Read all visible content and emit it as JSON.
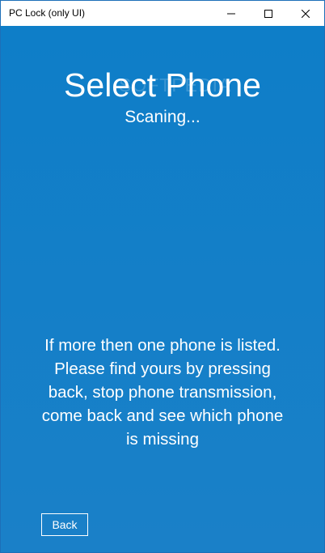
{
  "window": {
    "title": "PC Lock (only UI)"
  },
  "titlebar_controls": {
    "minimize_icon": "minimize-icon",
    "maximize_icon": "maximize-icon",
    "close_icon": "close-icon"
  },
  "main": {
    "heading": "Select Phone",
    "status": "Scaning...",
    "instructions": "If more then one phone is listed. Please find yours by pressing back, stop phone transmission, come back and see which phone is missing",
    "back_label": "Back",
    "watermark": "SOFTPEDIA"
  },
  "colors": {
    "background": "#0e7ec8",
    "text": "#ffffff",
    "titlebar": "#ffffff"
  }
}
